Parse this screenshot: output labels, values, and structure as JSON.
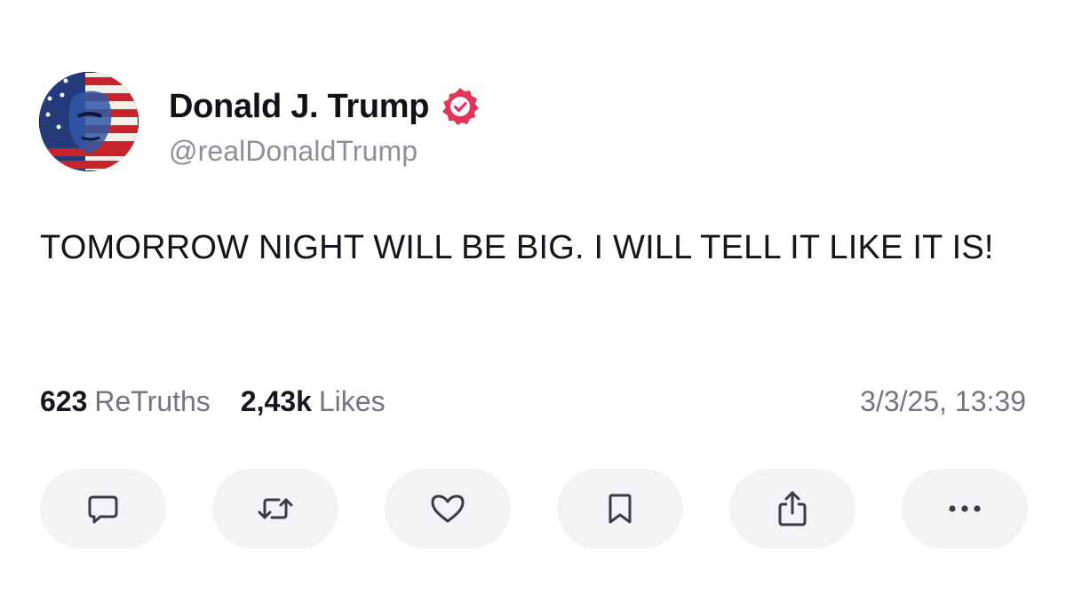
{
  "post": {
    "author": {
      "display_name": "Donald J. Trump",
      "handle": "@realDonaldTrump",
      "verified": true,
      "verified_color": "#e0365e",
      "avatar_icon": "profile-avatar-flag-portrait"
    },
    "text": "TOMORROW NIGHT WILL BE BIG. I WILL TELL IT LIKE IT IS!",
    "stats": {
      "retruths_count": "623",
      "retruths_label": "ReTruths",
      "likes_count": "2,43k",
      "likes_label": "Likes"
    },
    "timestamp": "3/3/25, 13:39"
  },
  "actions": [
    {
      "name": "reply",
      "icon": "comment-icon"
    },
    {
      "name": "retruth",
      "icon": "repost-icon"
    },
    {
      "name": "like",
      "icon": "heart-icon"
    },
    {
      "name": "bookmark",
      "icon": "bookmark-icon"
    },
    {
      "name": "share",
      "icon": "share-icon"
    },
    {
      "name": "more",
      "icon": "more-icon"
    }
  ],
  "colors": {
    "text_primary": "#111118",
    "text_secondary": "#8e8f98",
    "button_bg": "#f3f3f6",
    "icon": "#3a3b44"
  }
}
